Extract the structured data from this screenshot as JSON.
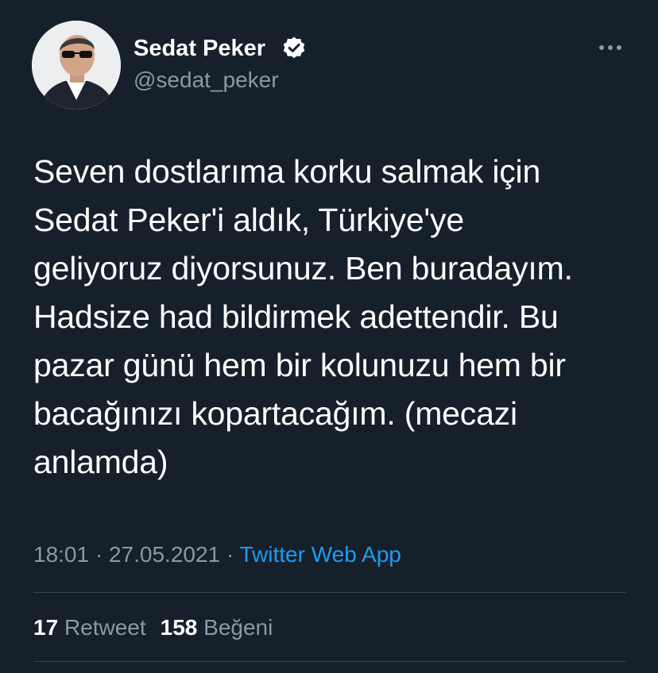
{
  "author": {
    "display_name": "Sedat Peker",
    "handle": "@sedat_peker",
    "verified": true
  },
  "tweet": {
    "text": "Seven dostlarıma korku salmak için\nSedat Peker'i aldık, Türkiye'ye\ngeliyoruz diyorsunuz. Ben buradayım.\nHadsize had bildirmek adettendir. Bu\npazar günü hem bir kolunuzu hem bir\nbacağınızı kopartacağım. (mecazi\nanlamda)",
    "time": "18:01",
    "date": "27.05.2021",
    "separator": "·",
    "source": "Twitter Web App"
  },
  "stats": {
    "retweets_count": "17",
    "retweets_label": "Retweet",
    "likes_count": "158",
    "likes_label": "Beğeni"
  },
  "icons": {
    "more": "more-horizontal-icon",
    "verified": "verified-badge-icon"
  },
  "colors": {
    "background": "#15202b",
    "text": "#ffffff",
    "secondary": "#8b98a5",
    "link": "#1d9bf0",
    "divider": "#38444d"
  }
}
